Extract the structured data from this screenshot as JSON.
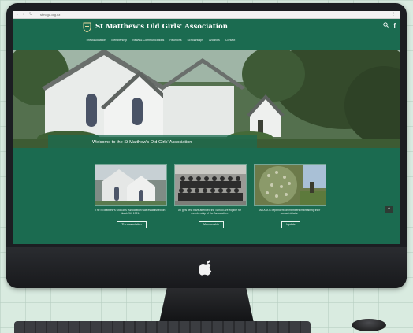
{
  "browser": {
    "back": "‹",
    "forward": "›",
    "reload": "↻",
    "url": "stmoga.org.nz",
    "menu": "⋮"
  },
  "site": {
    "title": "St Matthew's Old Girls' Association",
    "nav": [
      "The Association",
      "Membership",
      "News & Communications",
      "Reunions",
      "Scholarships",
      "Archives",
      "Contact"
    ],
    "search_icon": "search-icon",
    "facebook_icon": "facebook-icon",
    "accent_color": "#1b6b50"
  },
  "hero": {
    "caption": "Welcome to the St Matthew's Old Girls' Association"
  },
  "cards": [
    {
      "text": "The St Matthew's Old Girls' Association was established on March 9th 1921.",
      "button": "The Association"
    },
    {
      "text": "All girls who have attended the School are eligible for membership of the Association.",
      "button": "Membership"
    },
    {
      "text": "SMOGA is dependent on members maintaining their contact details.",
      "button": "Update"
    }
  ],
  "scroll_top": "^"
}
